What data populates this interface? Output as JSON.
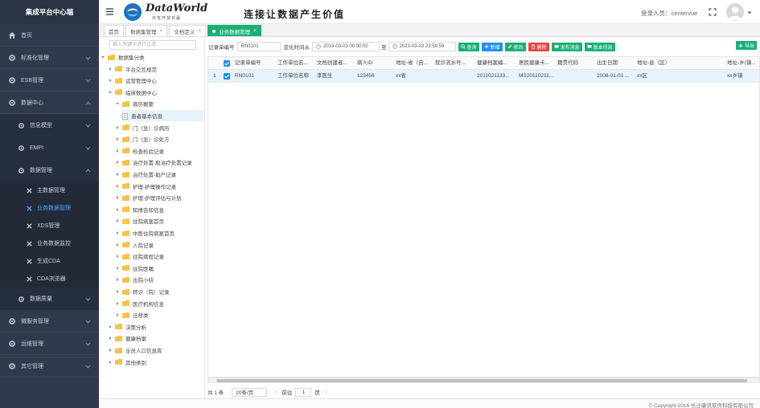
{
  "app": {
    "title": "集成平台中心端"
  },
  "header": {
    "logo_title": "DataWorld",
    "logo_sub": "共享开放共赢",
    "slogan": "连接让数据产生价值",
    "user_label": "登录人员：centervue"
  },
  "sidebar": {
    "items": [
      {
        "label": "首页",
        "icon": "home-icon"
      },
      {
        "label": "标准化管理",
        "icon": "gear-icon"
      },
      {
        "label": "ESB管理",
        "icon": "gear-icon"
      },
      {
        "label": "数据中心",
        "icon": "gear-icon",
        "expanded": true
      },
      {
        "label": "信息模型",
        "icon": "gear-icon",
        "level": 2
      },
      {
        "label": "EMPI",
        "icon": "gear-icon",
        "level": 2
      },
      {
        "label": "数据管理",
        "icon": "gear-icon",
        "level": 2,
        "expanded": true
      },
      {
        "label": "主数据管理",
        "icon": "tools-icon",
        "level": 3
      },
      {
        "label": "业务数据管理",
        "icon": "tools-icon",
        "level": 3,
        "active": true
      },
      {
        "label": "XDS管理",
        "icon": "tools-icon",
        "level": 3
      },
      {
        "label": "业务数据监控",
        "icon": "tools-icon",
        "level": 3
      },
      {
        "label": "生成CDA",
        "icon": "tools-icon",
        "level": 3
      },
      {
        "label": "CDA浏览器",
        "icon": "tools-icon",
        "level": 3
      },
      {
        "label": "数据质量",
        "icon": "gear-icon",
        "level": 2
      },
      {
        "label": "微服务管理",
        "icon": "gear-icon"
      },
      {
        "label": "运维管理",
        "icon": "gear-icon"
      },
      {
        "label": "其它管理",
        "icon": "gear-icon"
      }
    ]
  },
  "tabs": [
    {
      "label": "首页"
    },
    {
      "label": "数据集管理"
    },
    {
      "label": "文档定义"
    },
    {
      "label": "业务数据管理",
      "active": true
    }
  ],
  "tree": {
    "search_placeholder": "输入关键字进行过滤",
    "nodes": [
      {
        "label": "数据集分类",
        "depth": 0
      },
      {
        "label": "平台交互规范",
        "depth": 1
      },
      {
        "label": "运营管理中心",
        "depth": 1
      },
      {
        "label": "临床数据中心",
        "depth": 1
      },
      {
        "label": "病历概要",
        "depth": 2
      },
      {
        "label": "患者基本信息",
        "depth": 3,
        "selected": true
      },
      {
        "label": "门（急）诊病历",
        "depth": 2
      },
      {
        "label": "门（急）诊处方",
        "depth": 2
      },
      {
        "label": "检查检验记录",
        "depth": 2
      },
      {
        "label": "治疗处置-般治疗处置记录",
        "depth": 2
      },
      {
        "label": "治疗处置-助产记录",
        "depth": 2
      },
      {
        "label": "护理-护理操作记录",
        "depth": 2
      },
      {
        "label": "护理-护理评估与计划",
        "depth": 2
      },
      {
        "label": "知情告知信息",
        "depth": 2
      },
      {
        "label": "住院病案首页",
        "depth": 2
      },
      {
        "label": "中医住院病案首页",
        "depth": 2
      },
      {
        "label": "入院记录",
        "depth": 2
      },
      {
        "label": "住院病程记录",
        "depth": 2
      },
      {
        "label": "住院医嘱",
        "depth": 2
      },
      {
        "label": "出院小结",
        "depth": 2
      },
      {
        "label": "转诊（院）记录",
        "depth": 2
      },
      {
        "label": "医疗机构信息",
        "depth": 2
      },
      {
        "label": "迁移类",
        "depth": 2
      },
      {
        "label": "决策分析",
        "depth": 1
      },
      {
        "label": "健康档案",
        "depth": 1
      },
      {
        "label": "全员人口信息库",
        "depth": 1
      },
      {
        "label": "其他类别",
        "depth": 1
      }
    ]
  },
  "filter": {
    "record_no_label": "记录单编号",
    "record_no_value": "RN0101",
    "change_time_label": "变化时间从",
    "date_from": "2013-03-03 00:00:00",
    "date_sep": "至",
    "date_to": "2023-03-03 23:59:59"
  },
  "buttons": {
    "query": "查询",
    "add": "新增",
    "edit": "修改",
    "delete": "删除",
    "publish": "发布消息",
    "version": "版本信息",
    "export": "导出"
  },
  "table": {
    "columns": [
      "记录单编号",
      "工作单位名...",
      "文档创建者...",
      "病人ID",
      "地址-省（自...",
      "就诊流水号...",
      "健康档案编...",
      "居民健康卡...",
      "籍贯代码",
      "出生日期",
      "地址-县（区）",
      "地址-乡(镇..."
    ],
    "rows": [
      {
        "index": "1",
        "cells": [
          "RN0101",
          "工作单位名称",
          "李医生",
          "123456",
          "xx省",
          "",
          "2011021133...",
          "MS20110211...",
          "",
          "2008-01-01 ...",
          "xx区",
          "xx乡镇"
        ]
      }
    ]
  },
  "pager": {
    "total": "共 1 条",
    "page_size": "20条/页",
    "prev": "前往",
    "page": "1",
    "suffix": "页"
  },
  "footer": {
    "copyright": "© Copyright 2016 长沙康讯软件科技有限公司"
  },
  "colors": {
    "sidebar_bg": "#2f3a4c",
    "accent": "#1aaf74",
    "primary": "#1e8ff0",
    "danger": "#e84545"
  }
}
